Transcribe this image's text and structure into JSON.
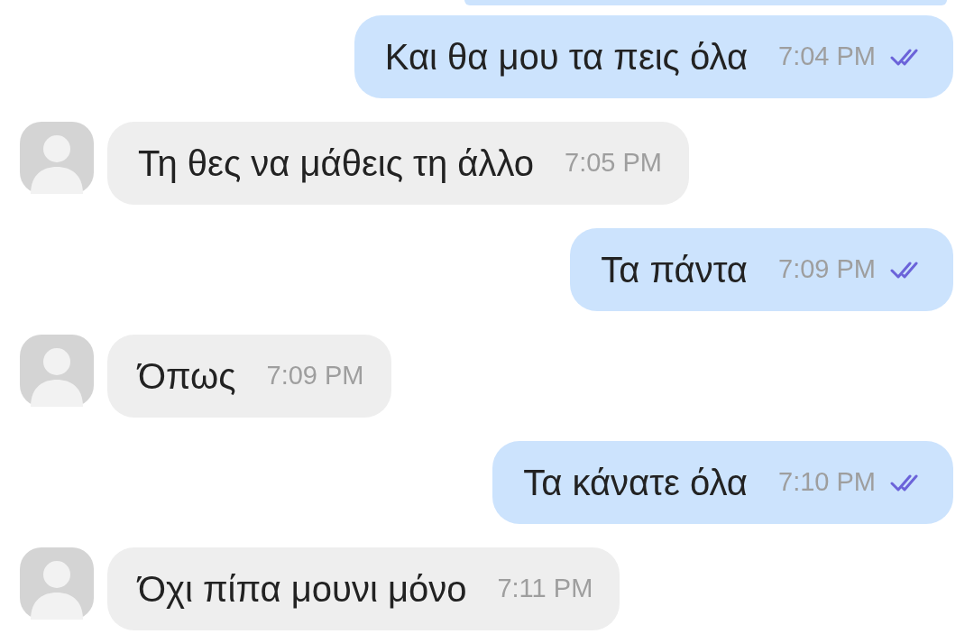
{
  "messages": [
    {
      "kind": "cut",
      "sent": true
    },
    {
      "kind": "text",
      "sent": true,
      "text": "Και θα μου τα πεις όλα",
      "time": "7:04 PM",
      "read": true
    },
    {
      "kind": "text",
      "sent": false,
      "text": "Τη θες να μάθεις τη άλλο",
      "time": "7:05 PM"
    },
    {
      "kind": "text",
      "sent": true,
      "text": "Τα πάντα",
      "time": "7:09 PM",
      "read": true
    },
    {
      "kind": "text",
      "sent": false,
      "text": "Όπως",
      "time": "7:09 PM"
    },
    {
      "kind": "text",
      "sent": true,
      "text": "Τα κάνατε όλα",
      "time": "7:10 PM",
      "read": true
    },
    {
      "kind": "text",
      "sent": false,
      "text": "Όχι πίπα μουνι μόνο",
      "time": "7:11 PM"
    }
  ]
}
